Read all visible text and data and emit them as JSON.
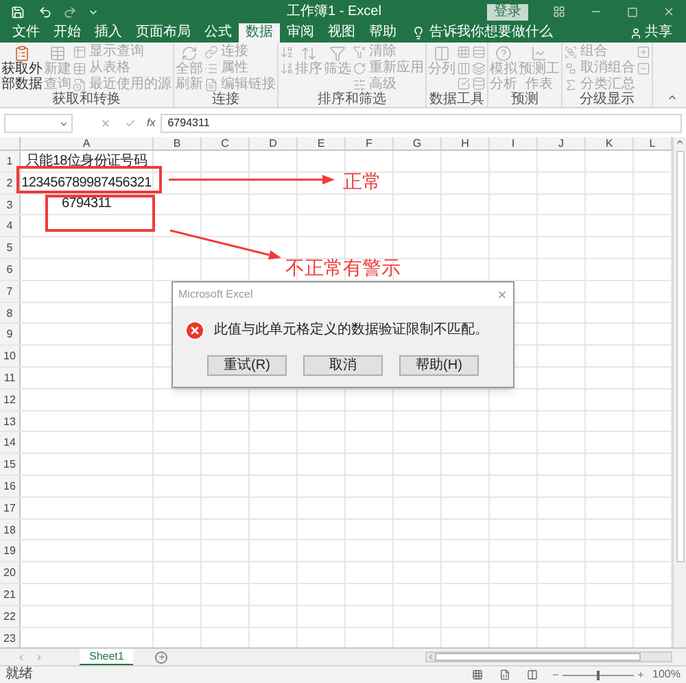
{
  "window": {
    "title": "工作簿1 - Excel",
    "sign_in": "登录"
  },
  "menu_tabs": [
    {
      "label": "文件",
      "selected": false
    },
    {
      "label": "开始",
      "selected": false
    },
    {
      "label": "插入",
      "selected": false
    },
    {
      "label": "页面布局",
      "selected": false
    },
    {
      "label": "公式",
      "selected": false
    },
    {
      "label": "数据",
      "selected": true
    },
    {
      "label": "审阅",
      "selected": false
    },
    {
      "label": "视图",
      "selected": false
    },
    {
      "label": "帮助",
      "selected": false
    }
  ],
  "tell_me": "告诉我你想要做什么",
  "share": "共享",
  "ribbon_groups": [
    {
      "label": "获取和转换",
      "columns": [
        [
          {
            "kind": "large",
            "label": "获取外部数据",
            "disabled": false
          }
        ],
        [
          {
            "kind": "large",
            "label": "新建查询",
            "disabled": true
          }
        ],
        [
          {
            "kind": "small",
            "label": "显示查询",
            "disabled": true
          },
          {
            "kind": "small",
            "label": "从表格",
            "disabled": true
          },
          {
            "kind": "small",
            "label": "最近使用的源",
            "disabled": true
          }
        ]
      ]
    },
    {
      "label": "连接",
      "columns": [
        [
          {
            "kind": "large",
            "label": "全部刷新",
            "disabled": true
          }
        ],
        [
          {
            "kind": "small",
            "label": "连接",
            "disabled": true
          },
          {
            "kind": "small",
            "label": "属性",
            "disabled": true
          },
          {
            "kind": "small",
            "label": "编辑链接",
            "disabled": true
          }
        ]
      ]
    },
    {
      "label": "排序和筛选",
      "columns": [
        [
          {
            "kind": "icon",
            "disabled": true
          },
          {
            "kind": "icon",
            "disabled": true
          }
        ],
        [
          {
            "kind": "large",
            "label": "排序",
            "disabled": true
          }
        ],
        [
          {
            "kind": "large",
            "label": "筛选",
            "disabled": true
          }
        ],
        [
          {
            "kind": "small",
            "label": "清除",
            "disabled": true
          },
          {
            "kind": "small",
            "label": "重新应用",
            "disabled": true
          },
          {
            "kind": "small",
            "label": "高级",
            "disabled": true
          }
        ]
      ]
    },
    {
      "label": "数据工具",
      "columns": [
        [
          {
            "kind": "large",
            "label": "分列",
            "disabled": true
          }
        ],
        [
          {
            "kind": "icon",
            "disabled": true
          },
          {
            "kind": "icon",
            "disabled": true
          },
          {
            "kind": "icon",
            "disabled": true
          }
        ],
        [
          {
            "kind": "icon",
            "disabled": true
          },
          {
            "kind": "icon",
            "disabled": true
          },
          {
            "kind": "icon",
            "disabled": true
          }
        ]
      ]
    },
    {
      "label": "预测",
      "columns": [
        [
          {
            "kind": "large",
            "label": "模拟分析",
            "disabled": true
          }
        ],
        [
          {
            "kind": "large",
            "label": "预测工作表",
            "disabled": true
          }
        ]
      ]
    },
    {
      "label": "分级显示",
      "columns": [
        [
          {
            "kind": "small",
            "label": "组合",
            "disabled": true
          },
          {
            "kind": "small",
            "label": "取消组合",
            "disabled": true
          },
          {
            "kind": "small",
            "label": "分类汇总",
            "disabled": true
          }
        ],
        [
          {
            "kind": "icon",
            "disabled": true
          },
          {
            "kind": "icon",
            "disabled": true
          }
        ]
      ]
    }
  ],
  "formula_bar": {
    "function_label": "fx",
    "value": "6794311"
  },
  "columns": [
    "A",
    "B",
    "C",
    "D",
    "E",
    "F",
    "G",
    "H",
    "I",
    "J",
    "K",
    "L"
  ],
  "rows": [
    {
      "header": "1",
      "values": [
        "只能18位身份证号码"
      ]
    },
    {
      "header": "2",
      "values": [
        "123456789987456321"
      ]
    },
    {
      "header": "3",
      "values": [
        "6794311"
      ]
    },
    {
      "header": "4"
    },
    {
      "header": "5"
    },
    {
      "header": "6"
    },
    {
      "header": "7"
    },
    {
      "header": "8"
    },
    {
      "header": "9"
    },
    {
      "header": "10"
    },
    {
      "header": "11"
    },
    {
      "header": "12"
    },
    {
      "header": "13"
    },
    {
      "header": "14"
    },
    {
      "header": "15"
    },
    {
      "header": "16"
    },
    {
      "header": "17"
    },
    {
      "header": "18"
    },
    {
      "header": "19"
    },
    {
      "header": "20"
    },
    {
      "header": "21"
    },
    {
      "header": "22"
    },
    {
      "header": "23"
    }
  ],
  "sheet_tabs": [
    {
      "label": "Sheet1",
      "selected": true
    }
  ],
  "status_bar": {
    "status": "就绪",
    "zoom": "100%",
    "zoom_level": {
      "level": 0.5
    }
  },
  "dialog": {
    "title": "Microsoft Excel",
    "message": "此值与此单元格定义的数据验证限制不匹配。",
    "buttons": [
      "重试(R)",
      "取消",
      "帮助(H)"
    ]
  },
  "annotations": [
    {
      "label": "正常"
    },
    {
      "label": "不正常有警示"
    }
  ]
}
